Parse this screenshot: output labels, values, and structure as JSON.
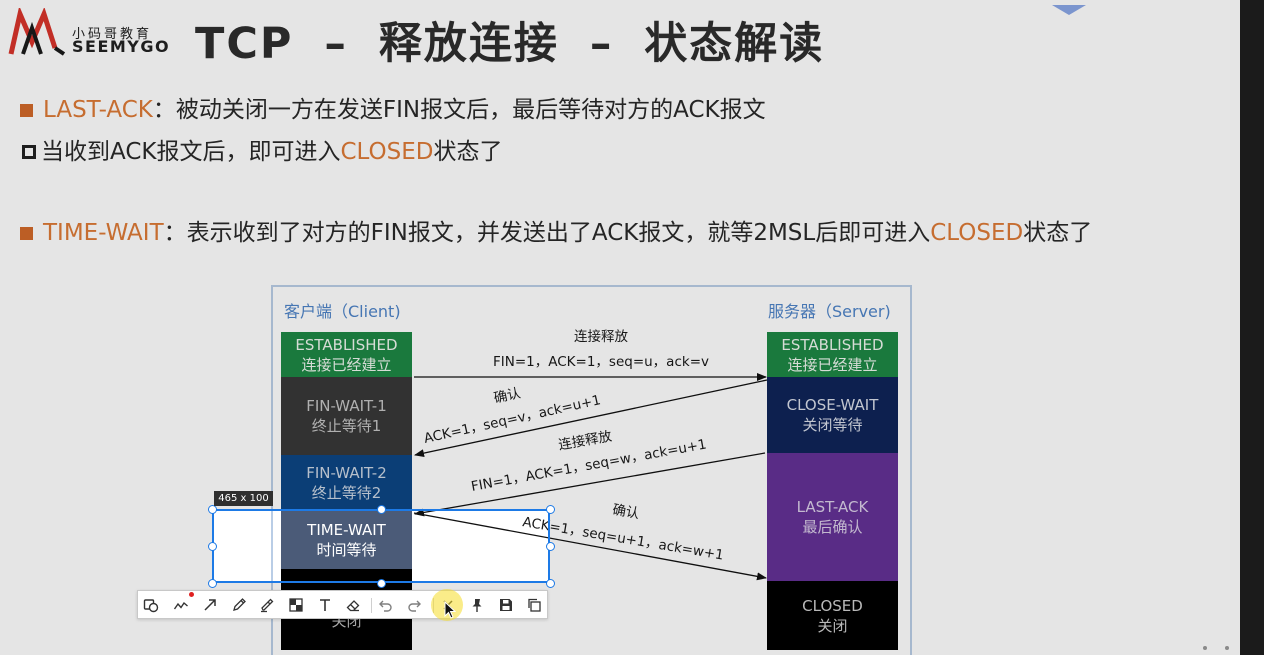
{
  "logo": {
    "cn": "小码哥教育",
    "en": "SEEMYGO",
    "mark_icon": "seemygo-m-logo-icon",
    "colors": {
      "red": "#d9342b",
      "black": "#1a1a1a"
    }
  },
  "title": "TCP – 释放连接 – 状态解读",
  "colors": {
    "accent": "#dd7a36",
    "text": "#2a2a2a",
    "diagram_label": "#4f84c8",
    "dim_overlay": "rgba(0,0,0,0.1)"
  },
  "bullets": [
    {
      "marker_icon": "filled-square-icon",
      "keyword": "LAST-ACK",
      "text": "：被动关闭一方在发送FIN报文后，最后等待对方的ACK报文"
    },
    {
      "marker_icon": "hollow-square-icon",
      "text": "当收到ACK报文后，即可进入",
      "keyword": "CLOSED",
      "tail": "状态了"
    },
    {
      "marker_icon": "filled-square-icon",
      "keyword": "TIME-WAIT",
      "text": "：表示收到了对方的FIN报文，并发送出了ACK报文，就等2MSL后即可进入",
      "keyword2": "CLOSED",
      "tail": "状态了"
    }
  ],
  "diagram": {
    "client": {
      "label": "客户端（Client)",
      "states": [
        {
          "name": "ESTABLISHED",
          "cn": "连接已经建立",
          "color": "#1d8745",
          "text_color": "#eef5ee"
        },
        {
          "name": "FIN-WAIT-1",
          "cn": "终止等待1",
          "color": "#383838",
          "text_color": "#c4c4c4"
        },
        {
          "name": "FIN-WAIT-2",
          "cn": "终止等待2",
          "color": "#0d4684",
          "text_color": "#cbd5e2"
        },
        {
          "name": "TIME-WAIT",
          "cn": "时间等待",
          "color": "#4b5b78",
          "text_color": "#ffffff"
        },
        {
          "cn": "关闭",
          "color": "#000000",
          "text_color": "#bdbdbd"
        }
      ]
    },
    "server": {
      "label": "服务器（Server)",
      "states": [
        {
          "name": "ESTABLISHED",
          "cn": "连接已经建立",
          "color": "#1d8745",
          "text_color": "#eef5ee"
        },
        {
          "name": "CLOSE-WAIT",
          "cn": "关闭等待",
          "color": "#0f2458",
          "text_color": "#d8dde8"
        },
        {
          "name": "LAST-ACK",
          "cn": "最后确认",
          "color": "#643296",
          "text_color": "#dacfe7"
        },
        {
          "name": "CLOSED",
          "cn": "关闭",
          "color": "#000000",
          "text_color": "#cfcfcf"
        }
      ]
    },
    "messages": [
      {
        "title": "连接释放",
        "detail": "FIN=1，ACK=1，seq=u，ack=v"
      },
      {
        "title": "确认",
        "detail": "ACK=1，seq=v，ack=u+1"
      },
      {
        "title": "连接释放",
        "detail": "FIN=1，ACK=1，seq=w，ack=u+1"
      },
      {
        "title": "确认",
        "detail": "ACK=1，seq=u+1，ack=w+1"
      }
    ]
  },
  "snip_tool": {
    "size_label": "465 x 100",
    "selection_color": "#1d7ae6",
    "tools": [
      "shape-icon",
      "curve-icon",
      "arrow-icon",
      "pencil-icon",
      "marker-icon",
      "mosaic-icon",
      "text-icon",
      "eraser-icon",
      "undo-icon",
      "redo-icon",
      "close-icon",
      "pin-icon",
      "save-icon",
      "copy-icon"
    ],
    "hovered_tool": "close-icon"
  }
}
